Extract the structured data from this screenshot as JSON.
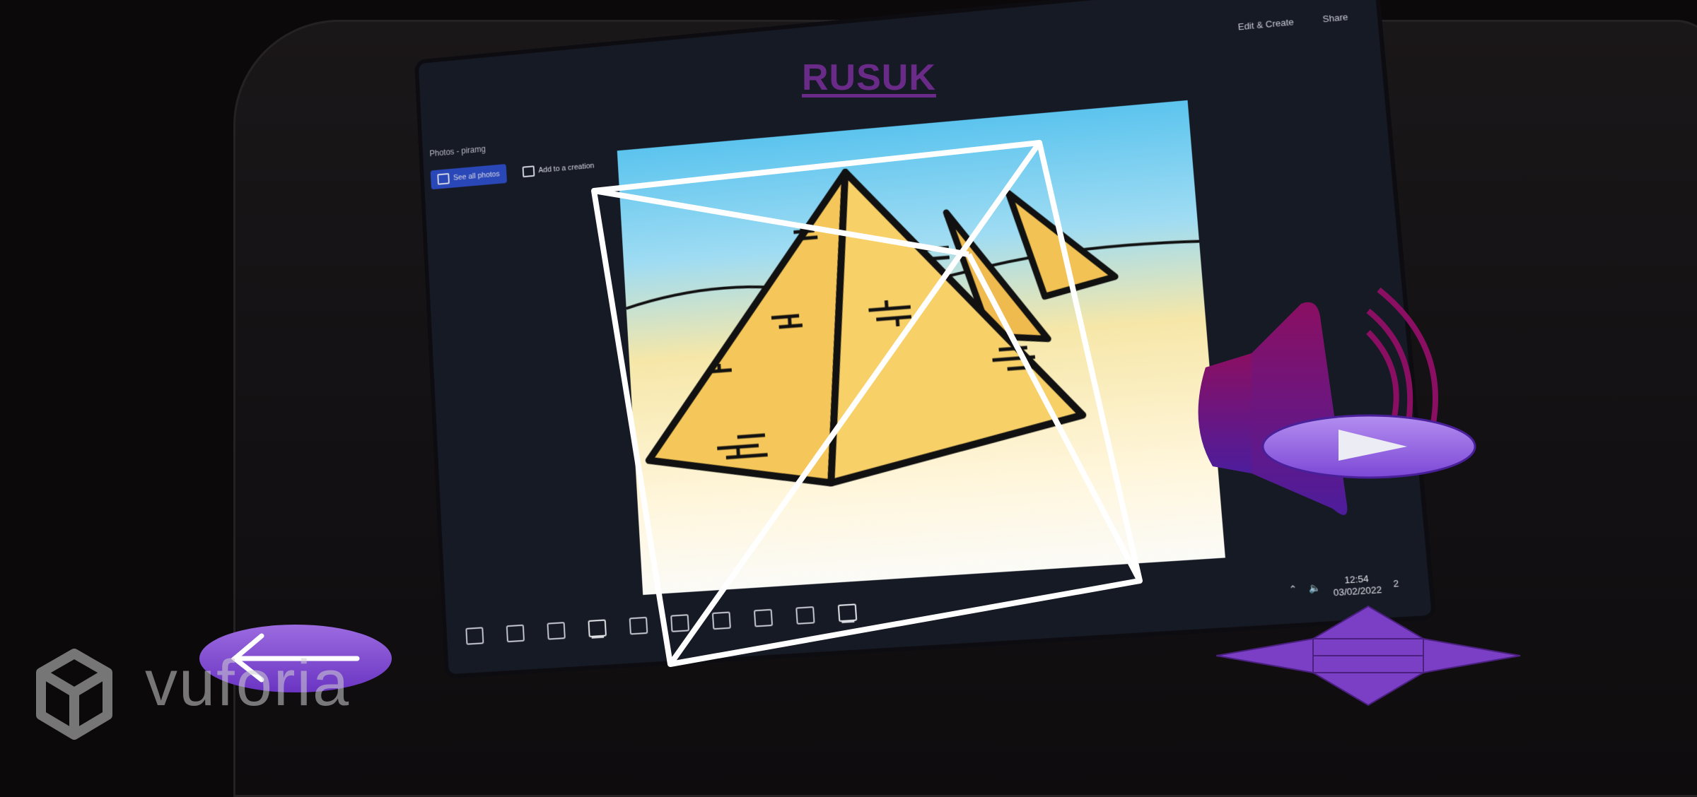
{
  "ar_title": "RUSUK",
  "watermark_text": "vuforia",
  "screen": {
    "window_title": "Photos - piramg",
    "buttons": [
      "See all photos",
      "Add to a creation"
    ],
    "toolbar_right": [
      "Edit & Create",
      "Share"
    ],
    "clock_time": "12:54",
    "clock_date": "03/02/2022",
    "notification_count": "2"
  },
  "colors": {
    "accent_purple": "#7b3fc6",
    "title_purple": "#6a2b88",
    "speaker_magenta": "#8a0f62",
    "wireframe": "#ffffff"
  },
  "icons": [
    "back-arrow-icon",
    "speaker-icon",
    "play-icon",
    "pyramid-net-icon",
    "vuforia-logo-icon"
  ]
}
